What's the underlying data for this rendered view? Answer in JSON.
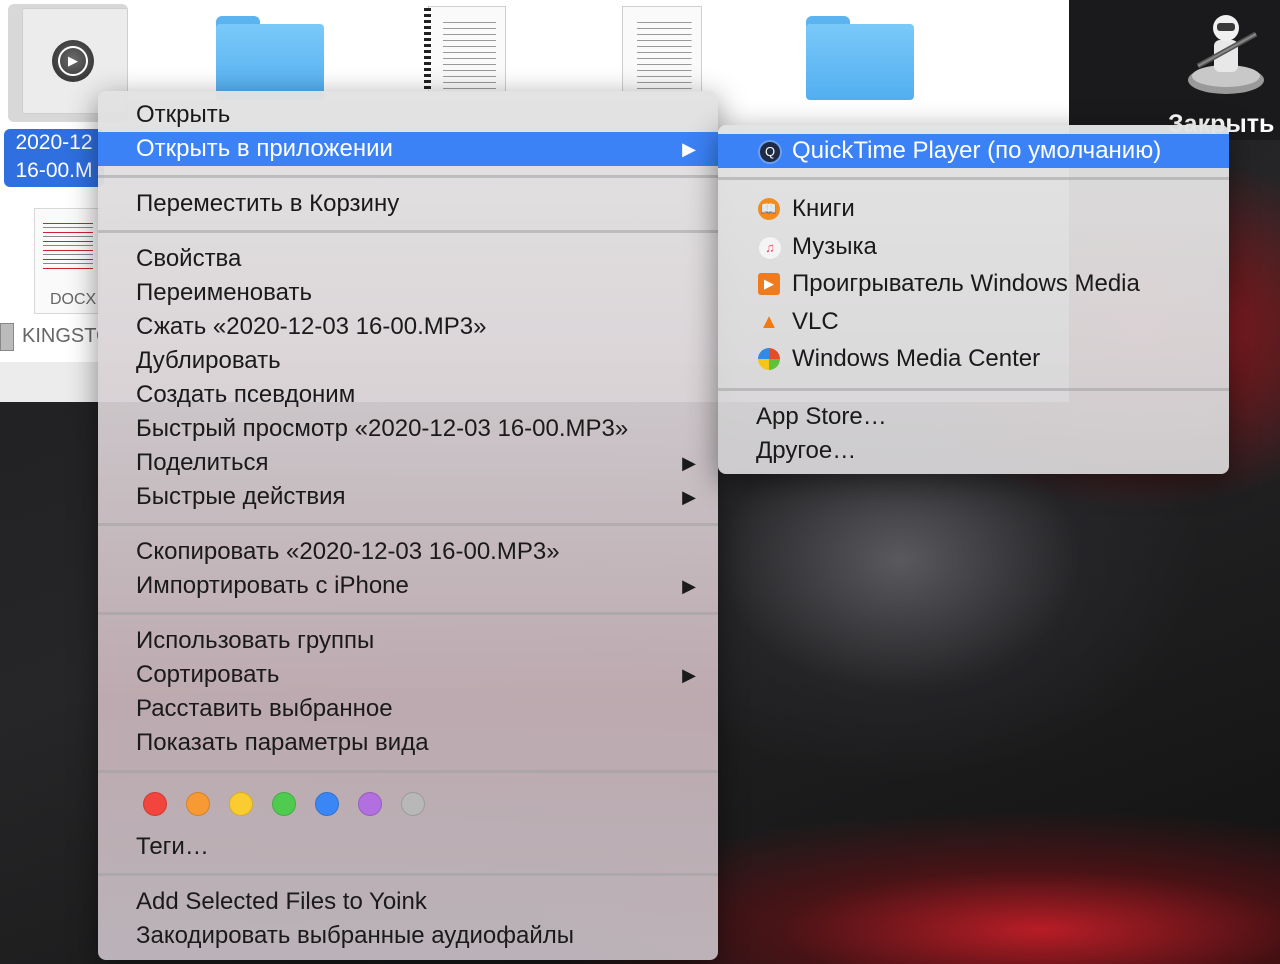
{
  "finder": {
    "selected_file_label": "2020-12\n16-00.M",
    "docx_label": "DOCX",
    "kingston_label": "KINGSTON"
  },
  "desktop": {
    "automator_label": "Закрыть"
  },
  "context_menu": {
    "open": "Открыть",
    "open_with": "Открыть в приложении",
    "move_to_trash": "Переместить в Корзину",
    "get_info": "Свойства",
    "rename": "Переименовать",
    "compress": "Сжать «2020-12-03 16-00.MP3»",
    "duplicate": "Дублировать",
    "make_alias": "Создать псевдоним",
    "quick_look": "Быстрый просмотр «2020-12-03 16-00.MP3»",
    "share": "Поделиться",
    "quick_actions": "Быстрые действия",
    "copy": "Скопировать «2020-12-03 16-00.MP3»",
    "import_iphone": "Импортировать с iPhone",
    "use_groups": "Использовать группы",
    "sort": "Сортировать",
    "clean_up": "Расставить выбранное",
    "view_options": "Показать параметры вида",
    "tags": "Теги…",
    "yoink": "Add Selected Files to Yoink",
    "encode_audio": "Закодировать выбранные аудиофайлы",
    "tag_colors": [
      "#f2453d",
      "#f79a33",
      "#fbcc30",
      "#4fcc4f",
      "#3a86f5",
      "#b26fdf",
      "#b8b8b8"
    ]
  },
  "open_with_menu": {
    "default_app": "QuickTime Player (по умолчанию)",
    "books": "Книги",
    "music": "Музыка",
    "wmp": "Проигрыватель Windows Media",
    "vlc": "VLC",
    "wmc": "Windows Media Center",
    "app_store": "App Store…",
    "other": "Другое…"
  },
  "colors": {
    "highlight": "#3b82f6",
    "selection": "#2f6fe0"
  }
}
